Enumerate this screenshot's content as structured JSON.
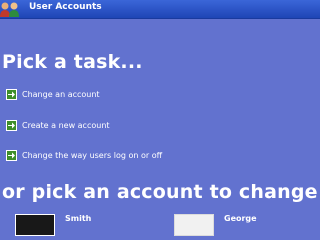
{
  "window": {
    "title": "User Accounts",
    "icon": "users-icon"
  },
  "tasks_section": {
    "heading": "Pick a task...",
    "items": [
      {
        "label": "Change an account",
        "icon": "green-arrow-icon"
      },
      {
        "label": "Create a new account",
        "icon": "green-arrow-icon"
      },
      {
        "label": "Change the way users log on or off",
        "icon": "green-arrow-icon"
      }
    ]
  },
  "accounts_section": {
    "heading": "or pick an account to change",
    "accounts": [
      {
        "name": "Smith",
        "picture": "dark-avatar"
      },
      {
        "name": "George",
        "picture": "light-avatar"
      }
    ]
  },
  "colors": {
    "background": "#6272cf",
    "titlebar": "#2a52c4",
    "task_arrow": "#3e8e2b",
    "text": "#ffffff"
  }
}
